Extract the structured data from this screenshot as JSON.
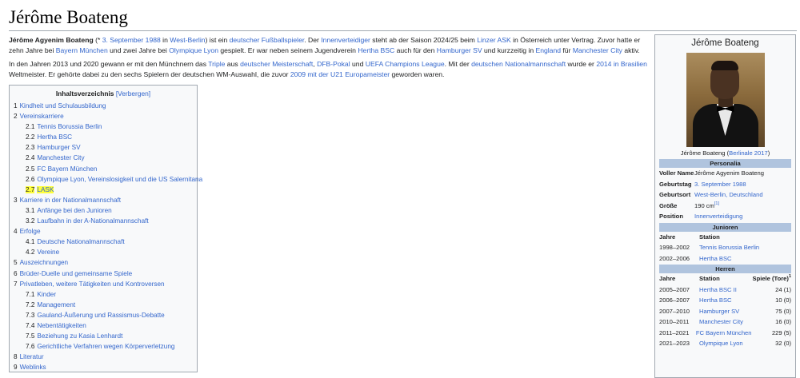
{
  "page": {
    "title": "Jérôme Boateng",
    "intro1": [
      {
        "t": "Jérôme Agyenim Boateng",
        "b": true
      },
      {
        "t": " (* "
      },
      {
        "t": "3. September 1988",
        "l": true
      },
      {
        "t": " in "
      },
      {
        "t": "West-Berlin",
        "l": true
      },
      {
        "t": ") ist ein "
      },
      {
        "t": "deutscher",
        "l": true
      },
      {
        "t": " "
      },
      {
        "t": "Fußballspieler",
        "l": true
      },
      {
        "t": ". Der "
      },
      {
        "t": "Innenverteidiger",
        "l": true
      },
      {
        "t": " steht ab der Saison 2024/25 beim "
      },
      {
        "t": "Linzer ASK",
        "l": true
      },
      {
        "t": " in Österreich unter Vertrag. Zuvor hatte er zehn Jahre bei "
      },
      {
        "t": "Bayern München",
        "l": true
      },
      {
        "t": " und zwei Jahre bei "
      },
      {
        "t": "Olympique Lyon",
        "l": true
      },
      {
        "t": " gespielt. Er war neben seinem Jugendverein "
      },
      {
        "t": "Hertha BSC",
        "l": true
      },
      {
        "t": " auch für den "
      },
      {
        "t": "Hamburger SV",
        "l": true
      },
      {
        "t": " und kurzzeitig in "
      },
      {
        "t": "England",
        "l": true
      },
      {
        "t": " für "
      },
      {
        "t": "Manchester City",
        "l": true
      },
      {
        "t": " aktiv."
      }
    ],
    "intro2": [
      {
        "t": "In den Jahren 2013 und 2020 gewann er mit den Münchnern das "
      },
      {
        "t": "Triple",
        "l": true
      },
      {
        "t": " aus "
      },
      {
        "t": "deutscher Meisterschaft",
        "l": true
      },
      {
        "t": ", "
      },
      {
        "t": "DFB-Pokal",
        "l": true
      },
      {
        "t": " und "
      },
      {
        "t": "UEFA Champions League",
        "l": true
      },
      {
        "t": ". Mit der "
      },
      {
        "t": "deutschen Nationalmannschaft",
        "l": true
      },
      {
        "t": " wurde er "
      },
      {
        "t": "2014 in Brasilien",
        "l": true
      },
      {
        "t": " Weltmeister. Er gehörte dabei zu den sechs Spielern der deutschen WM-Auswahl, die zuvor "
      },
      {
        "t": "2009 mit der U21 Europameister",
        "l": true
      },
      {
        "t": " geworden waren."
      }
    ]
  },
  "toc": {
    "title": "Inhaltsverzeichnis",
    "toggle": "[Verbergen]",
    "items": [
      {
        "num": "1",
        "label": "Kindheit und Schulausbildung",
        "level": 1
      },
      {
        "num": "2",
        "label": "Vereinskarriere",
        "level": 1
      },
      {
        "num": "2.1",
        "label": "Tennis Borussia Berlin",
        "level": 2
      },
      {
        "num": "2.2",
        "label": "Hertha BSC",
        "level": 2
      },
      {
        "num": "2.3",
        "label": "Hamburger SV",
        "level": 2
      },
      {
        "num": "2.4",
        "label": "Manchester City",
        "level": 2
      },
      {
        "num": "2.5",
        "label": "FC Bayern München",
        "level": 2
      },
      {
        "num": "2.6",
        "label": "Olympique Lyon, Vereinslosigkeit und die US Salernitana",
        "level": 2
      },
      {
        "num": "2.7",
        "label": "LASK",
        "level": 2,
        "highlight": true
      },
      {
        "num": "3",
        "label": "Karriere in der Nationalmannschaft",
        "level": 1
      },
      {
        "num": "3.1",
        "label": "Anfänge bei den Junioren",
        "level": 2
      },
      {
        "num": "3.2",
        "label": "Laufbahn in der A-Nationalmannschaft",
        "level": 2
      },
      {
        "num": "4",
        "label": "Erfolge",
        "level": 1
      },
      {
        "num": "4.1",
        "label": "Deutsche Nationalmannschaft",
        "level": 2
      },
      {
        "num": "4.2",
        "label": "Vereine",
        "level": 2
      },
      {
        "num": "5",
        "label": "Auszeichnungen",
        "level": 1
      },
      {
        "num": "6",
        "label": "Brüder-Duelle und gemeinsame Spiele",
        "level": 1
      },
      {
        "num": "7",
        "label": "Privatleben, weitere Tätigkeiten und Kontroversen",
        "level": 1
      },
      {
        "num": "7.1",
        "label": "Kinder",
        "level": 2
      },
      {
        "num": "7.2",
        "label": "Management",
        "level": 2
      },
      {
        "num": "7.3",
        "label": "Gauland-Äußerung und Rassismus-Debatte",
        "level": 2
      },
      {
        "num": "7.4",
        "label": "Nebentätigkeiten",
        "level": 2
      },
      {
        "num": "7.5",
        "label": "Beziehung zu Kasia Lenhardt",
        "level": 2
      },
      {
        "num": "7.6",
        "label": "Gerichtliche Verfahren wegen Körperverletzung",
        "level": 2
      },
      {
        "num": "8",
        "label": "Literatur",
        "level": 1
      },
      {
        "num": "9",
        "label": "Weblinks",
        "level": 1
      }
    ]
  },
  "infobox": {
    "name": "Jérôme Boateng",
    "caption_plain": "Jérôme Boateng (",
    "caption_link": "Berlinale 2017",
    "caption_end": ")",
    "sections": {
      "personalia": "Personalia",
      "junioren": "Junioren",
      "herren": "Herren"
    },
    "personalia": [
      {
        "label": "Voller Name",
        "value": "Jérôme Agyenim Boateng",
        "link": false
      },
      {
        "label": "Geburtstag",
        "value": "3. September 1988",
        "link": true
      },
      {
        "label": "Geburtsort",
        "value": "West-Berlin, Deutschland",
        "link": true
      },
      {
        "label": "Größe",
        "value": "190 cm",
        "sup": "[1]",
        "link": false
      },
      {
        "label": "Position",
        "value": "Innenverteidigung",
        "link": true
      }
    ],
    "junioren_header": {
      "jahre": "Jahre",
      "station": "Station"
    },
    "junioren": [
      {
        "jahre": "1998–2002",
        "station": "Tennis Borussia Berlin"
      },
      {
        "jahre": "2002–2006",
        "station": "Hertha BSC"
      }
    ],
    "herren_header": {
      "jahre": "Jahre",
      "station": "Station",
      "spiele": "Spiele (Tore)",
      "sup": "1"
    },
    "herren": [
      {
        "jahre": "2005–2007",
        "station": "Hertha BSC II",
        "spiele": "24 (1)"
      },
      {
        "jahre": "2006–2007",
        "station": "Hertha BSC",
        "spiele": "10 (0)"
      },
      {
        "jahre": "2007–2010",
        "station": "Hamburger SV",
        "spiele": "75 (0)"
      },
      {
        "jahre": "2010–2011",
        "station": "Manchester City",
        "spiele": "16 (0)"
      },
      {
        "jahre": "2011–2021",
        "station": "FC Bayern München",
        "spiele": "229 (5)"
      },
      {
        "jahre": "2021–2023",
        "station": "Olympique Lyon",
        "spiele": "32 (0)"
      }
    ]
  }
}
